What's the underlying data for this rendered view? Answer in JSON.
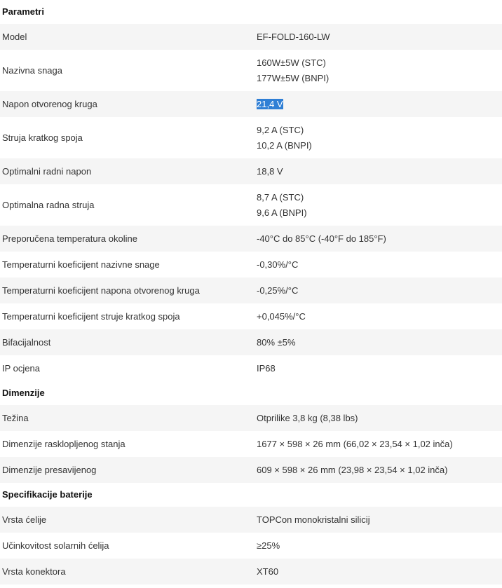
{
  "sections": [
    {
      "title": "Parametri",
      "rows": [
        {
          "label": "Model",
          "values": [
            "EF-FOLD-160-LW"
          ]
        },
        {
          "label": "Nazivna snaga",
          "values": [
            "160W±5W (STC)",
            "177W±5W (BNPI)"
          ]
        },
        {
          "label": "Napon otvorenog kruga",
          "values": [
            "21,4 V"
          ],
          "selected": true
        },
        {
          "label": "Struja kratkog spoja",
          "values": [
            "9,2 A (STC)",
            "10,2 A (BNPI)"
          ]
        },
        {
          "label": "Optimalni radni napon",
          "values": [
            "18,8 V"
          ]
        },
        {
          "label": "Optimalna radna struja",
          "values": [
            "8,7 A (STC)",
            "9,6 A (BNPI)"
          ]
        },
        {
          "label": "Preporučena temperatura okoline",
          "values": [
            "-40°C do 85°C (-40°F do 185°F)"
          ]
        },
        {
          "label": "Temperaturni koeficijent nazivne snage",
          "values": [
            "-0,30%/°C"
          ]
        },
        {
          "label": "Temperaturni koeficijent napona otvorenog kruga",
          "values": [
            "-0,25%/°C"
          ]
        },
        {
          "label": "Temperaturni koeficijent struje kratkog spoja",
          "values": [
            "+0,045%/°C"
          ]
        },
        {
          "label": "Bifacijalnost",
          "values": [
            "80% ±5%"
          ]
        },
        {
          "label": "IP ocjena",
          "values": [
            "IP68"
          ]
        }
      ]
    },
    {
      "title": "Dimenzije",
      "rows": [
        {
          "label": "Težina",
          "values": [
            "Otprilike 3,8 kg (8,38 lbs)"
          ]
        },
        {
          "label": "Dimenzije rasklopljenog stanja",
          "values": [
            "1677 × 598 × 26 mm (66,02 × 23,54 × 1,02 inča)"
          ]
        },
        {
          "label": "Dimenzije presavijenog",
          "values": [
            "609 × 598 × 26 mm (23,98 × 23,54 × 1,02 inča)"
          ]
        }
      ]
    },
    {
      "title": "Specifikacije baterije",
      "rows": [
        {
          "label": "Vrsta ćelije",
          "values": [
            "TOPCon monokristalni silicij"
          ]
        },
        {
          "label": "Učinkovitost solarnih ćelija",
          "values": [
            "≥25%"
          ]
        },
        {
          "label": "Vrsta konektora",
          "values": [
            "XT60"
          ]
        }
      ]
    }
  ]
}
